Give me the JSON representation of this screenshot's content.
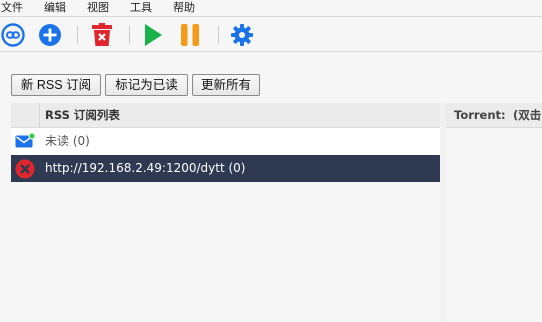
{
  "menu": {
    "items": [
      "文件",
      "编辑",
      "视图",
      "工具",
      "帮助"
    ]
  },
  "toolbar": {
    "buttons": [
      {
        "name": "add-torrent-link",
        "icon": "link-icon",
        "color": "#1a73e8"
      },
      {
        "name": "add-torrent",
        "icon": "plus-circle-icon",
        "color": "#1a73e8"
      },
      {
        "name": "delete",
        "icon": "trash-icon",
        "color": "#e0262d"
      },
      {
        "name": "resume",
        "icon": "play-icon",
        "color": "#19b24a"
      },
      {
        "name": "pause",
        "icon": "pause-icon",
        "color": "#f59b1a"
      },
      {
        "name": "settings",
        "icon": "gear-icon",
        "color": "#1a73e8"
      }
    ]
  },
  "actions": {
    "new_rss": "新 RSS 订阅",
    "mark_read": "标记为已读",
    "update_all": "更新所有"
  },
  "feeds": {
    "header": "RSS 订阅列表",
    "rows": [
      {
        "label": "未读 (0)",
        "icon": "mail-icon",
        "selected": false
      },
      {
        "label": "http://192.168.2.49:1200/dytt (0)",
        "icon": "error-icon",
        "selected": true
      }
    ]
  },
  "torrents": {
    "header": "Torrent:",
    "hint": "(双击"
  },
  "colors": {
    "selected_row": "#2f3a52",
    "accent_blue": "#1a73e8",
    "error_red": "#e0262d"
  }
}
